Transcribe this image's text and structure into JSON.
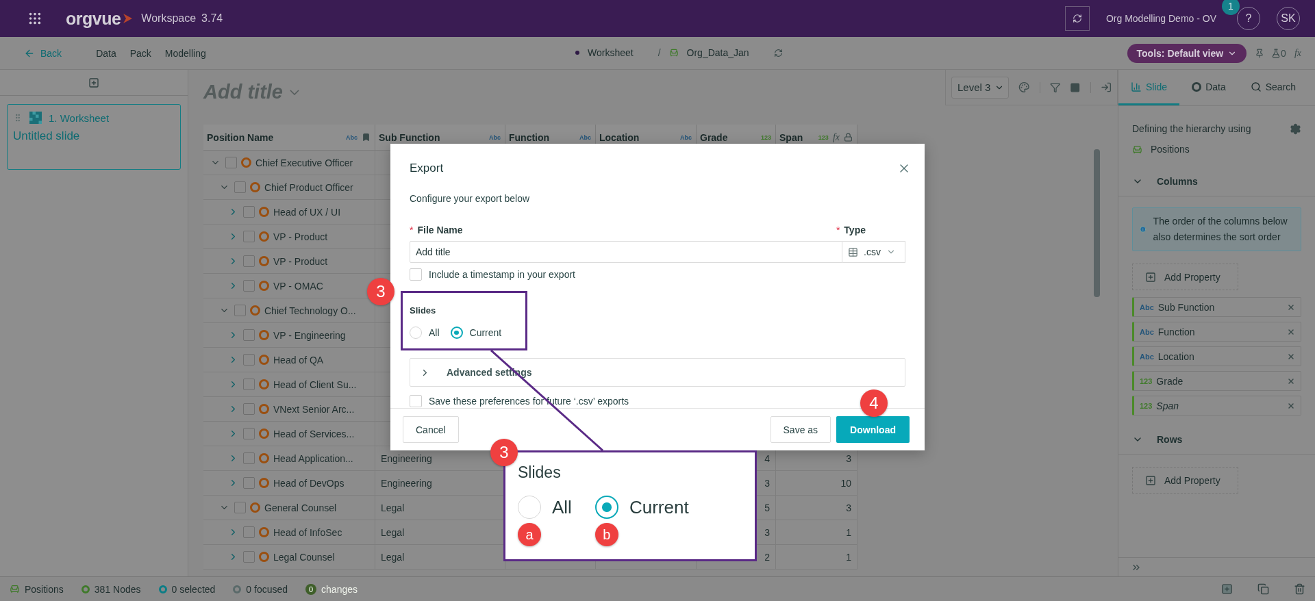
{
  "top_bar": {
    "app_name": "orgvue",
    "workspace_label": "Workspace",
    "version": "3.74",
    "project": "Org Modelling Demo - OV",
    "notification_count": "1",
    "help": "?",
    "user_initials": "SK"
  },
  "nav": {
    "back": "Back",
    "menu": [
      "Data",
      "Pack",
      "Modelling"
    ],
    "breadcrumb": [
      {
        "label": "Worksheet",
        "kind": "dot"
      },
      {
        "label": "Org_Data_Jan",
        "kind": "dataset"
      }
    ],
    "separator": "/",
    "tools": "Tools: Default view",
    "flask_count": "0",
    "formula": "fx"
  },
  "slides_panel": {
    "slides": [
      {
        "number_title": "1. Worksheet",
        "name": "Untitled slide",
        "selected": true
      }
    ]
  },
  "canvas": {
    "title_placeholder": "Add title",
    "level": "Level 3"
  },
  "table": {
    "columns": [
      {
        "label": "Position Name",
        "type_tag": "Abc",
        "kind": "text",
        "bookmark": true
      },
      {
        "label": "Sub Function",
        "type_tag": "Abc",
        "kind": "text"
      },
      {
        "label": "Function",
        "type_tag": "Abc",
        "kind": "text"
      },
      {
        "label": "Location",
        "type_tag": "Abc",
        "kind": "text"
      },
      {
        "label": "Grade",
        "type_tag": "123",
        "kind": "number"
      },
      {
        "label": "Span",
        "type_tag": "123",
        "kind": "number",
        "formula": "fx",
        "locked": true
      }
    ],
    "rows": [
      {
        "name": "Chief Executive Officer",
        "expanded": true,
        "checked": false,
        "children": [
          {
            "name": "Chief Product Officer",
            "expanded": true,
            "checked": false,
            "children": [
              {
                "name": "Head of UX / UI",
                "expanded": false,
                "checked": false
              },
              {
                "name": "VP - Product",
                "expanded": false,
                "checked": false
              },
              {
                "name": "VP - Product",
                "expanded": false,
                "checked": false
              },
              {
                "name": "VP - OMAC",
                "expanded": false,
                "checked": false
              }
            ]
          },
          {
            "name": "Chief Technology O...",
            "expanded": true,
            "checked": false,
            "children": [
              {
                "name": "VP - Engineering",
                "expanded": false,
                "checked": false
              },
              {
                "name": "Head of QA",
                "expanded": false,
                "checked": false
              },
              {
                "name": "Head of Client Su...",
                "expanded": false,
                "checked": false
              },
              {
                "name": "VNext Senior Arc...",
                "expanded": false,
                "checked": false
              },
              {
                "name": "Head of Services...",
                "expanded": false,
                "checked": false
              },
              {
                "name": "Head Application...",
                "expanded": false,
                "checked": false,
                "sub_function": "Engineering",
                "grade": "4",
                "span": "3"
              },
              {
                "name": "Head of DevOps",
                "expanded": false,
                "checked": false,
                "sub_function": "Engineering",
                "grade": "3",
                "span": "10"
              }
            ]
          },
          {
            "name": "General Counsel",
            "expanded": true,
            "checked": false,
            "sub_function": "Legal",
            "grade": "5",
            "span": "3",
            "children": [
              {
                "name": "Head of InfoSec",
                "expanded": false,
                "checked": false,
                "sub_function": "Legal",
                "grade": "3",
                "span": "1"
              },
              {
                "name": "Legal Counsel",
                "expanded": false,
                "checked": false,
                "sub_function": "Legal",
                "grade": "2",
                "span": "1"
              }
            ]
          }
        ]
      }
    ]
  },
  "status_bar": {
    "items": [
      {
        "kind": "positions",
        "text": "Positions"
      },
      {
        "kind": "nodes",
        "text": "381 Nodes"
      },
      {
        "kind": "selected",
        "text": "0 selected"
      },
      {
        "kind": "focused",
        "text": "0 focused"
      },
      {
        "kind": "changes",
        "count": "0",
        "text": "changes",
        "disabled": true
      }
    ]
  },
  "right_panel": {
    "tabs": [
      {
        "label": "Slide",
        "kind": "slide",
        "selected": true
      },
      {
        "label": "Data",
        "kind": "data",
        "selected": false
      },
      {
        "label": "Search",
        "kind": "search",
        "selected": false
      }
    ],
    "hierarchy_label": "Defining the hierarchy using",
    "hierarchy_value": "Positions",
    "sections": [
      {
        "title": "Columns",
        "expanded": true,
        "info": "The order of the columns below also determines the sort order",
        "add_label": "Add Property",
        "chips": [
          {
            "type_tag": "Abc",
            "kind": "text",
            "label": "Sub Function",
            "italic": false
          },
          {
            "type_tag": "Abc",
            "kind": "text",
            "label": "Function",
            "italic": false
          },
          {
            "type_tag": "Abc",
            "kind": "text",
            "label": "Location",
            "italic": false
          },
          {
            "type_tag": "123",
            "kind": "number",
            "label": "Grade",
            "italic": false
          },
          {
            "type_tag": "123",
            "kind": "number",
            "label": "Span",
            "italic": true
          }
        ]
      },
      {
        "title": "Rows",
        "expanded": true,
        "add_label": "Add Property"
      }
    ]
  },
  "dialog": {
    "title": "Export",
    "subtitle": "Configure your export below",
    "file_name": {
      "required_mark": "*",
      "label": "File Name",
      "value": "Add title"
    },
    "type": {
      "required_mark": "*",
      "label": "Type",
      "value": ".csv"
    },
    "timestamp": {
      "label": "Include a timestamp in your export",
      "checked": false
    },
    "slides_label": "Slides",
    "slide_options": [
      {
        "label": "All",
        "selected": false
      },
      {
        "label": "Current",
        "selected": true
      }
    ],
    "advanced": {
      "label": "Advanced settings",
      "expanded": false
    },
    "save_prefs": {
      "label": "Save these preferences for future ‘.csv’ exports",
      "checked": false
    },
    "buttons": [
      {
        "label": "Cancel",
        "kind": "secondary"
      },
      {
        "label": "Save as",
        "kind": "secondary"
      },
      {
        "label": "Download",
        "kind": "primary"
      }
    ]
  },
  "annotations": {
    "step_badges": [
      {
        "label": "3"
      },
      {
        "label": "4"
      },
      {
        "label": "3"
      }
    ],
    "callout": {
      "title": "Slides",
      "options": [
        {
          "label": "All",
          "selected": false,
          "marker": "a"
        },
        {
          "label": "Current",
          "selected": true,
          "marker": "b"
        }
      ]
    }
  }
}
